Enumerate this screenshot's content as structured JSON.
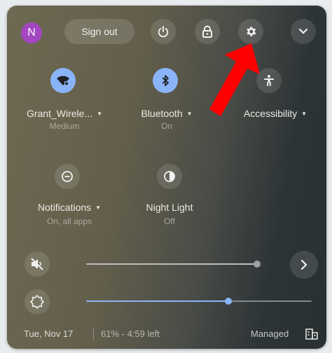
{
  "header": {
    "avatar_letter": "N",
    "sign_out_label": "Sign out",
    "icons": {
      "power": "power-icon",
      "lock": "lock-icon",
      "settings": "settings-gear-icon",
      "collapse": "chevron-down-icon"
    }
  },
  "tiles": [
    {
      "name": "Grant_Wirele...",
      "status": "Medium",
      "icon": "wifi-icon",
      "active": true
    },
    {
      "name": "Bluetooth",
      "status": "On",
      "icon": "bluetooth-icon",
      "active": true
    },
    {
      "name": "Accessibility",
      "status": "",
      "icon": "accessibility-icon",
      "active": false
    },
    {
      "name": "Notifications",
      "status": "On, all apps",
      "icon": "notifications-icon",
      "active": false
    },
    {
      "name": "Night Light",
      "status": "Off",
      "icon": "night-light-icon",
      "active": false
    }
  ],
  "sliders": {
    "volume": {
      "icon": "volume-muted-icon",
      "muted": true,
      "level_percent": 100
    },
    "brightness": {
      "icon": "brightness-icon",
      "level_percent": 63
    }
  },
  "footer": {
    "date": "Tue, Nov 17",
    "battery": "61% - 4:59 left",
    "managed": "Managed",
    "managed_icon": "enterprise-building-icon"
  },
  "annotation": {
    "icon": "red-arrow-icon",
    "color": "#ff0000"
  },
  "colors": {
    "accent": "#8ab4f8",
    "avatar": "#a347c1"
  }
}
